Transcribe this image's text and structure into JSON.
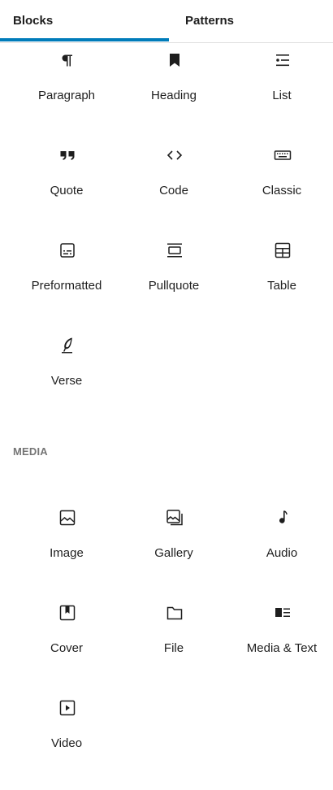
{
  "tabs": [
    {
      "label": "Blocks",
      "active": true
    },
    {
      "label": "Patterns",
      "active": false
    }
  ],
  "text_section": {
    "blocks": [
      {
        "label": "Paragraph",
        "icon": "paragraph-icon"
      },
      {
        "label": "Heading",
        "icon": "heading-icon"
      },
      {
        "label": "List",
        "icon": "list-icon"
      },
      {
        "label": "Quote",
        "icon": "quote-icon"
      },
      {
        "label": "Code",
        "icon": "code-icon"
      },
      {
        "label": "Classic",
        "icon": "keyboard-icon"
      },
      {
        "label": "Preformatted",
        "icon": "preformatted-icon"
      },
      {
        "label": "Pullquote",
        "icon": "pullquote-icon"
      },
      {
        "label": "Table",
        "icon": "table-icon"
      },
      {
        "label": "Verse",
        "icon": "verse-icon"
      }
    ]
  },
  "media_section": {
    "title": "MEDIA",
    "blocks": [
      {
        "label": "Image",
        "icon": "image-icon"
      },
      {
        "label": "Gallery",
        "icon": "gallery-icon"
      },
      {
        "label": "Audio",
        "icon": "audio-icon"
      },
      {
        "label": "Cover",
        "icon": "cover-icon"
      },
      {
        "label": "File",
        "icon": "file-icon"
      },
      {
        "label": "Media & Text",
        "icon": "media-text-icon"
      },
      {
        "label": "Video",
        "icon": "video-icon"
      }
    ]
  },
  "colors": {
    "accent": "#007cba",
    "text": "#1e1e1e",
    "muted": "#757575"
  }
}
